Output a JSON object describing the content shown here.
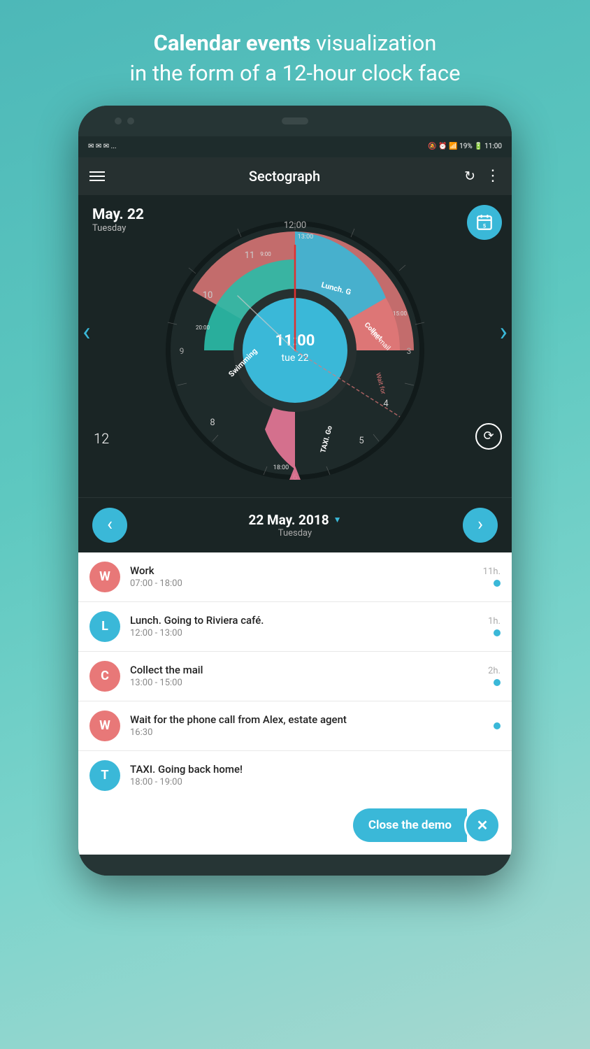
{
  "header": {
    "line1_bold": "Calendar events",
    "line1_normal": " visualization",
    "line2": "in the form of a 12-hour clock face"
  },
  "status_bar": {
    "left": "✉ ✉ ✉ ...",
    "right": "🔕 ⏰ 📶 19% 🔋 11:00"
  },
  "app_bar": {
    "title": "Sectograph",
    "refresh_icon": "↻",
    "menu_icon": "⋮"
  },
  "clock": {
    "date": "May. 22",
    "day": "Tuesday",
    "center_time": "11:00",
    "center_date": "tue 22",
    "number_12": "12",
    "number_10": "10",
    "number_11": "11",
    "number_4": "4",
    "number_5": "5",
    "number_8": "8"
  },
  "nav": {
    "prev_label": "‹",
    "next_label": "›",
    "full_date": "22 May. 2018",
    "weekday": "Tuesday",
    "dropdown_char": "▼"
  },
  "events": [
    {
      "avatar_letter": "W",
      "avatar_color": "#e87878",
      "title": "Work",
      "time": "07:00 - 18:00",
      "duration": "11h.",
      "dot_color": "#3ab8d8"
    },
    {
      "avatar_letter": "L",
      "avatar_color": "#3ab8d8",
      "title": "Lunch. Going to Riviera café.",
      "time": "12:00 - 13:00",
      "duration": "1h.",
      "dot_color": "#3ab8d8"
    },
    {
      "avatar_letter": "C",
      "avatar_color": "#e87878",
      "title": "Collect the mail",
      "time": "13:00 - 15:00",
      "duration": "2h.",
      "dot_color": "#3ab8d8"
    },
    {
      "avatar_letter": "W",
      "avatar_color": "#e87878",
      "title": "Wait for the phone call from Alex, estate agent",
      "time": "16:30",
      "duration": "",
      "dot_color": "#3ab8d8"
    },
    {
      "avatar_letter": "T",
      "avatar_color": "#3ab8d8",
      "title": "TAXI. Going back home!",
      "time": "18:00 - 19:00",
      "duration": "",
      "dot_color": ""
    }
  ],
  "close_demo": {
    "label": "Close the demo",
    "x_icon": "✕"
  }
}
